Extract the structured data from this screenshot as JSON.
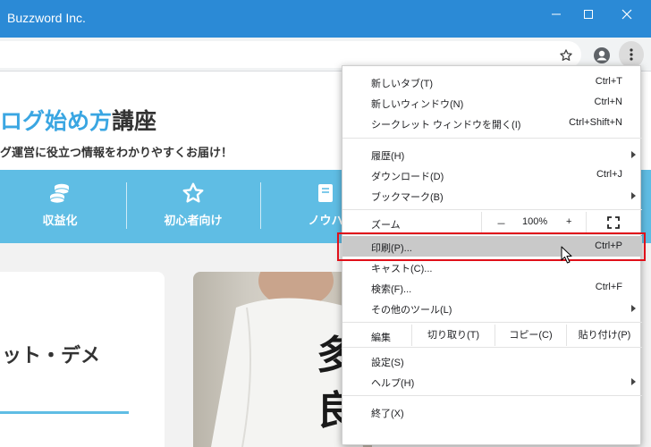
{
  "window": {
    "title": "Buzzword Inc.",
    "controls": {
      "minimize": "minimize-icon",
      "maximize": "maximize-icon",
      "close": "close-icon"
    }
  },
  "toolbar": {
    "icons": [
      "star-icon",
      "profile-icon",
      "kebab-menu-icon"
    ]
  },
  "page": {
    "hero": {
      "title_blue": "ログ始め方",
      "title_dark": "講座",
      "subtitle": "グ運営に役立つ情報をわかりやすくお届け！"
    },
    "categories": [
      {
        "label": "収益化",
        "icon": "coins-icon"
      },
      {
        "label": "初心者向け",
        "icon": "star-outline-icon"
      },
      {
        "label": "ノウハ",
        "icon": "book-icon"
      }
    ],
    "card_title": "ット・デメ",
    "colors": {
      "accent": "#3aa6e2",
      "catbar": "#5fbde4",
      "titlebar": "#2b8ad6"
    }
  },
  "menu": {
    "items": [
      {
        "label": "新しいタブ(T)",
        "shortcut": "Ctrl+T"
      },
      {
        "label": "新しいウィンドウ(N)",
        "shortcut": "Ctrl+N"
      },
      {
        "label": "シークレット ウィンドウを開く(I)",
        "shortcut": "Ctrl+Shift+N"
      },
      {
        "label": "履歴(H)",
        "shortcut": ""
      },
      {
        "label": "ダウンロード(D)",
        "shortcut": "Ctrl+J"
      },
      {
        "label": "ブックマーク(B)",
        "shortcut": ""
      },
      {
        "label": "印刷(P)...",
        "shortcut": "Ctrl+P"
      },
      {
        "label": "キャスト(C)...",
        "shortcut": ""
      },
      {
        "label": "検索(F)...",
        "shortcut": "Ctrl+F"
      },
      {
        "label": "その他のツール(L)",
        "shortcut": ""
      },
      {
        "label": "設定(S)",
        "shortcut": ""
      },
      {
        "label": "ヘルプ(H)",
        "shortcut": ""
      },
      {
        "label": "終了(X)",
        "shortcut": ""
      }
    ],
    "zoom": {
      "label": "ズーム",
      "minus": "－",
      "value": "100%",
      "plus": "+"
    },
    "edit": {
      "label": "編集",
      "cut": "切り取り(T)",
      "copy": "コピー(C)",
      "paste": "貼り付け(P)"
    },
    "highlighted": "印刷(P)..."
  }
}
